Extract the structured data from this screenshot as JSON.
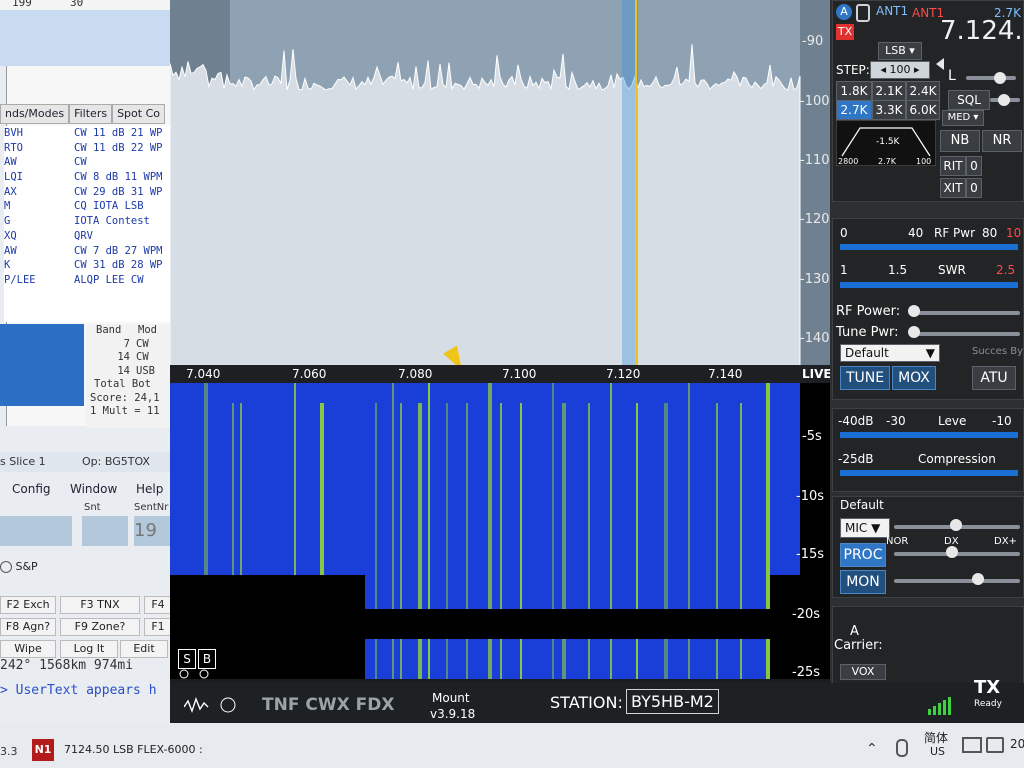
{
  "left_window": {
    "top_numbers": [
      "199",
      "30"
    ],
    "tabs": [
      "nds/Modes",
      "Filters",
      "Spot Co"
    ],
    "spots": [
      {
        "call": "BVH",
        "mode": "CW 11 dB 21 WP"
      },
      {
        "call": "RTO",
        "mode": "CW 11 dB 22 WP"
      },
      {
        "call": "AW",
        "mode": "CW"
      },
      {
        "call": "LQI",
        "mode": "CW 8 dB 11 WPM"
      },
      {
        "call": "AX",
        "mode": "CW 29 dB 31 WP"
      },
      {
        "call": "M",
        "mode": "CQ IOTA LSB"
      },
      {
        "call": "G",
        "mode": "IOTA Contest"
      },
      {
        "call": "XQ",
        "mode": "QRV"
      },
      {
        "call": "AW",
        "mode": "CW 7 dB 27 WPM"
      },
      {
        "call": "K",
        "mode": "CW 31 dB 28 WP"
      },
      {
        "call": "P/LEE",
        "mode": "ALQP LEE CW"
      }
    ],
    "band_table": {
      "headers": [
        "Band",
        "Mod"
      ],
      "rows": [
        [
          "7",
          "CW"
        ],
        [
          "14",
          "CW"
        ],
        [
          "14",
          "USB"
        ]
      ],
      "total": "Total  Bot",
      "score": "Score: 24,1",
      "mult": "1 Mult = 11"
    },
    "slice": "s Slice 1",
    "op": "Op: BG5TOX",
    "menu": [
      "Config",
      "Window",
      "Help"
    ],
    "snt_label": "Snt",
    "sentnr_label": "SentNr",
    "sentnr_value": "19",
    "sp_label": "S&P",
    "fkeys": [
      [
        "F2 Exch",
        "F3 TNX",
        "F4"
      ],
      [
        "F8 Agn?",
        "F9 Zone?",
        "F1"
      ],
      [
        "Wipe",
        "Log It",
        "Edit"
      ]
    ],
    "distance": "242° 1568km 974mi",
    "usertext": "> UserText appears h"
  },
  "panadapter": {
    "db_labels": [
      "-90",
      "-100",
      "-110",
      "-120",
      "-130",
      "-140"
    ],
    "freq_labels": [
      "7.040",
      "7.060",
      "7.080",
      "7.100",
      "7.120",
      "7.140"
    ],
    "live_label": "LIVE",
    "time_labels": [
      "-5s",
      "-10s",
      "-15s",
      "-20s",
      "-25s"
    ],
    "sb_buttons": [
      "S",
      "B"
    ]
  },
  "radio": {
    "ant1_label": "ANT1",
    "ant1_red": "ANT1",
    "bandwidth_top": "2.7K",
    "frequency": "7.124.5",
    "tx_badge": "TX",
    "mode": "LSB",
    "step_label": "STEP:",
    "step_value": "100",
    "filters": [
      "1.8K",
      "2.1K",
      "2.4K",
      "2.7K",
      "3.3K",
      "6.0K"
    ],
    "selected_filter": "2.7K",
    "filter_graph": {
      "center": "-1.5K",
      "left": "2800",
      "mid": "2.7K",
      "right": "100"
    },
    "sql_label": "SQL",
    "l_label": "L",
    "agc_mode": "MED",
    "nb_label": "NB",
    "nr_label": "NR",
    "rit_label": "RIT",
    "rit_value": "0",
    "xit_label": "XIT",
    "xit_value": "0",
    "rfpwr_scale": [
      "0",
      "40",
      "RF Pwr",
      "80",
      "10"
    ],
    "swr_scale": [
      "1",
      "1.5",
      "SWR",
      "2.5"
    ],
    "rf_power_label": "RF Power:",
    "tune_pwr_label": "Tune Pwr:",
    "tx_profile": "Default",
    "success_label": "Succes By",
    "tune_label": "TUNE",
    "mox_label": "MOX",
    "atu_label": "ATU",
    "level_scale": [
      "-40dB",
      "-30",
      "Leve",
      "-10"
    ],
    "compression_scale": [
      "-25dB",
      "Compression"
    ],
    "mic_profile": "Default",
    "mic_label": "MIC",
    "mic_positions": [
      "NOR",
      "DX",
      "DX+"
    ],
    "proc_label": "PROC",
    "mon_label": "MON",
    "carrier_a": "A",
    "carrier_label": "Carrier:",
    "vox_label": "VOX"
  },
  "status_bar": {
    "tnf": "TNF CWX FDX",
    "mount": "Mount",
    "version": "v3.9.18",
    "station_label": "STATION:",
    "station_value": "BY5HB-M2",
    "tx_label": "TX",
    "ready_label": "Ready"
  },
  "taskbar": {
    "left_number": "3.3",
    "app_title": "7124.50 LSB FLEX-6000 :",
    "lang_top": "简体",
    "lang_bottom": "US",
    "clock_fragment": "20"
  },
  "colors": {
    "panadapter_bg": "#6f8091",
    "passband": "#9fb3c8",
    "waterfall_blue": "#1a3fd8",
    "signal_green": "#9dde2a",
    "accent_blue": "#2f76c6",
    "tx_red": "#e03131",
    "cursor_yellow": "#f0c419"
  }
}
